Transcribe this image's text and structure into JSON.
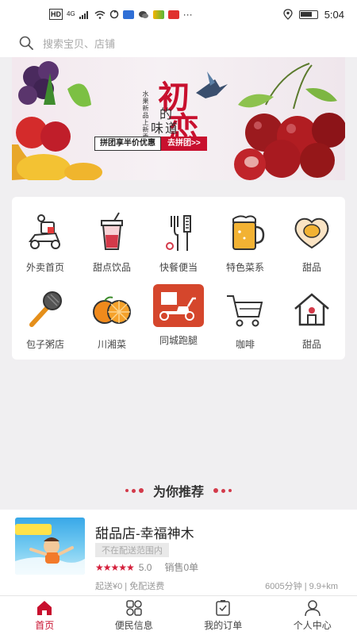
{
  "status_bar": {
    "left_icons": [
      "HD",
      "4G",
      "signal",
      "wifi",
      "sync-icon",
      "app-icon",
      "chat-icon",
      "app-icon-2",
      "app-icon-3",
      "more-icon"
    ],
    "more": "···",
    "time": "5:04"
  },
  "search": {
    "placeholder": "搜索宝贝、店铺"
  },
  "banner": {
    "title_char_1": "初",
    "title_char_2": "恋",
    "title_sub_1": "的",
    "title_sub_2": "味",
    "title_sub_3": "道",
    "vertical_tagline": "水果新品上新季",
    "promo_left": "拼团享半价优惠",
    "promo_right": "去拼团>>"
  },
  "categories": [
    {
      "label": "外卖首页",
      "icon": "delivery-scooter-icon"
    },
    {
      "label": "甜点饮品",
      "icon": "drink-cup-icon"
    },
    {
      "label": "快餐便当",
      "icon": "utensils-icon"
    },
    {
      "label": "特色菜系",
      "icon": "beer-mug-icon"
    },
    {
      "label": "甜品",
      "icon": "heart-egg-icon"
    },
    {
      "label": "包子粥店",
      "icon": "microphone-icon"
    },
    {
      "label": "川湘菜",
      "icon": "oranges-icon"
    },
    {
      "label": "同城跑腿",
      "icon": "delivery-bike-icon"
    },
    {
      "label": "咖啡",
      "icon": "shopping-cart-icon"
    },
    {
      "label": "甜品",
      "icon": "house-icon"
    }
  ],
  "recommend": {
    "title": "为你推荐"
  },
  "store": {
    "name": "甜品店-幸福神木",
    "badge": "不在配送范围内",
    "stars": "★★★★★",
    "rating": "5.0",
    "sales": "销售0单",
    "delivery": "起送¥0 | 免配送费",
    "distance": "6005分钟 | 9.9+km"
  },
  "bottom_nav": [
    {
      "label": "首页",
      "icon": "home-icon",
      "active": true
    },
    {
      "label": "便民信息",
      "icon": "grid-icon",
      "active": false
    },
    {
      "label": "我的订单",
      "icon": "clipboard-icon",
      "active": false
    },
    {
      "label": "个人中心",
      "icon": "user-icon",
      "active": false
    }
  ],
  "colors": {
    "accent": "#c8102e",
    "background": "#f0eff1"
  }
}
